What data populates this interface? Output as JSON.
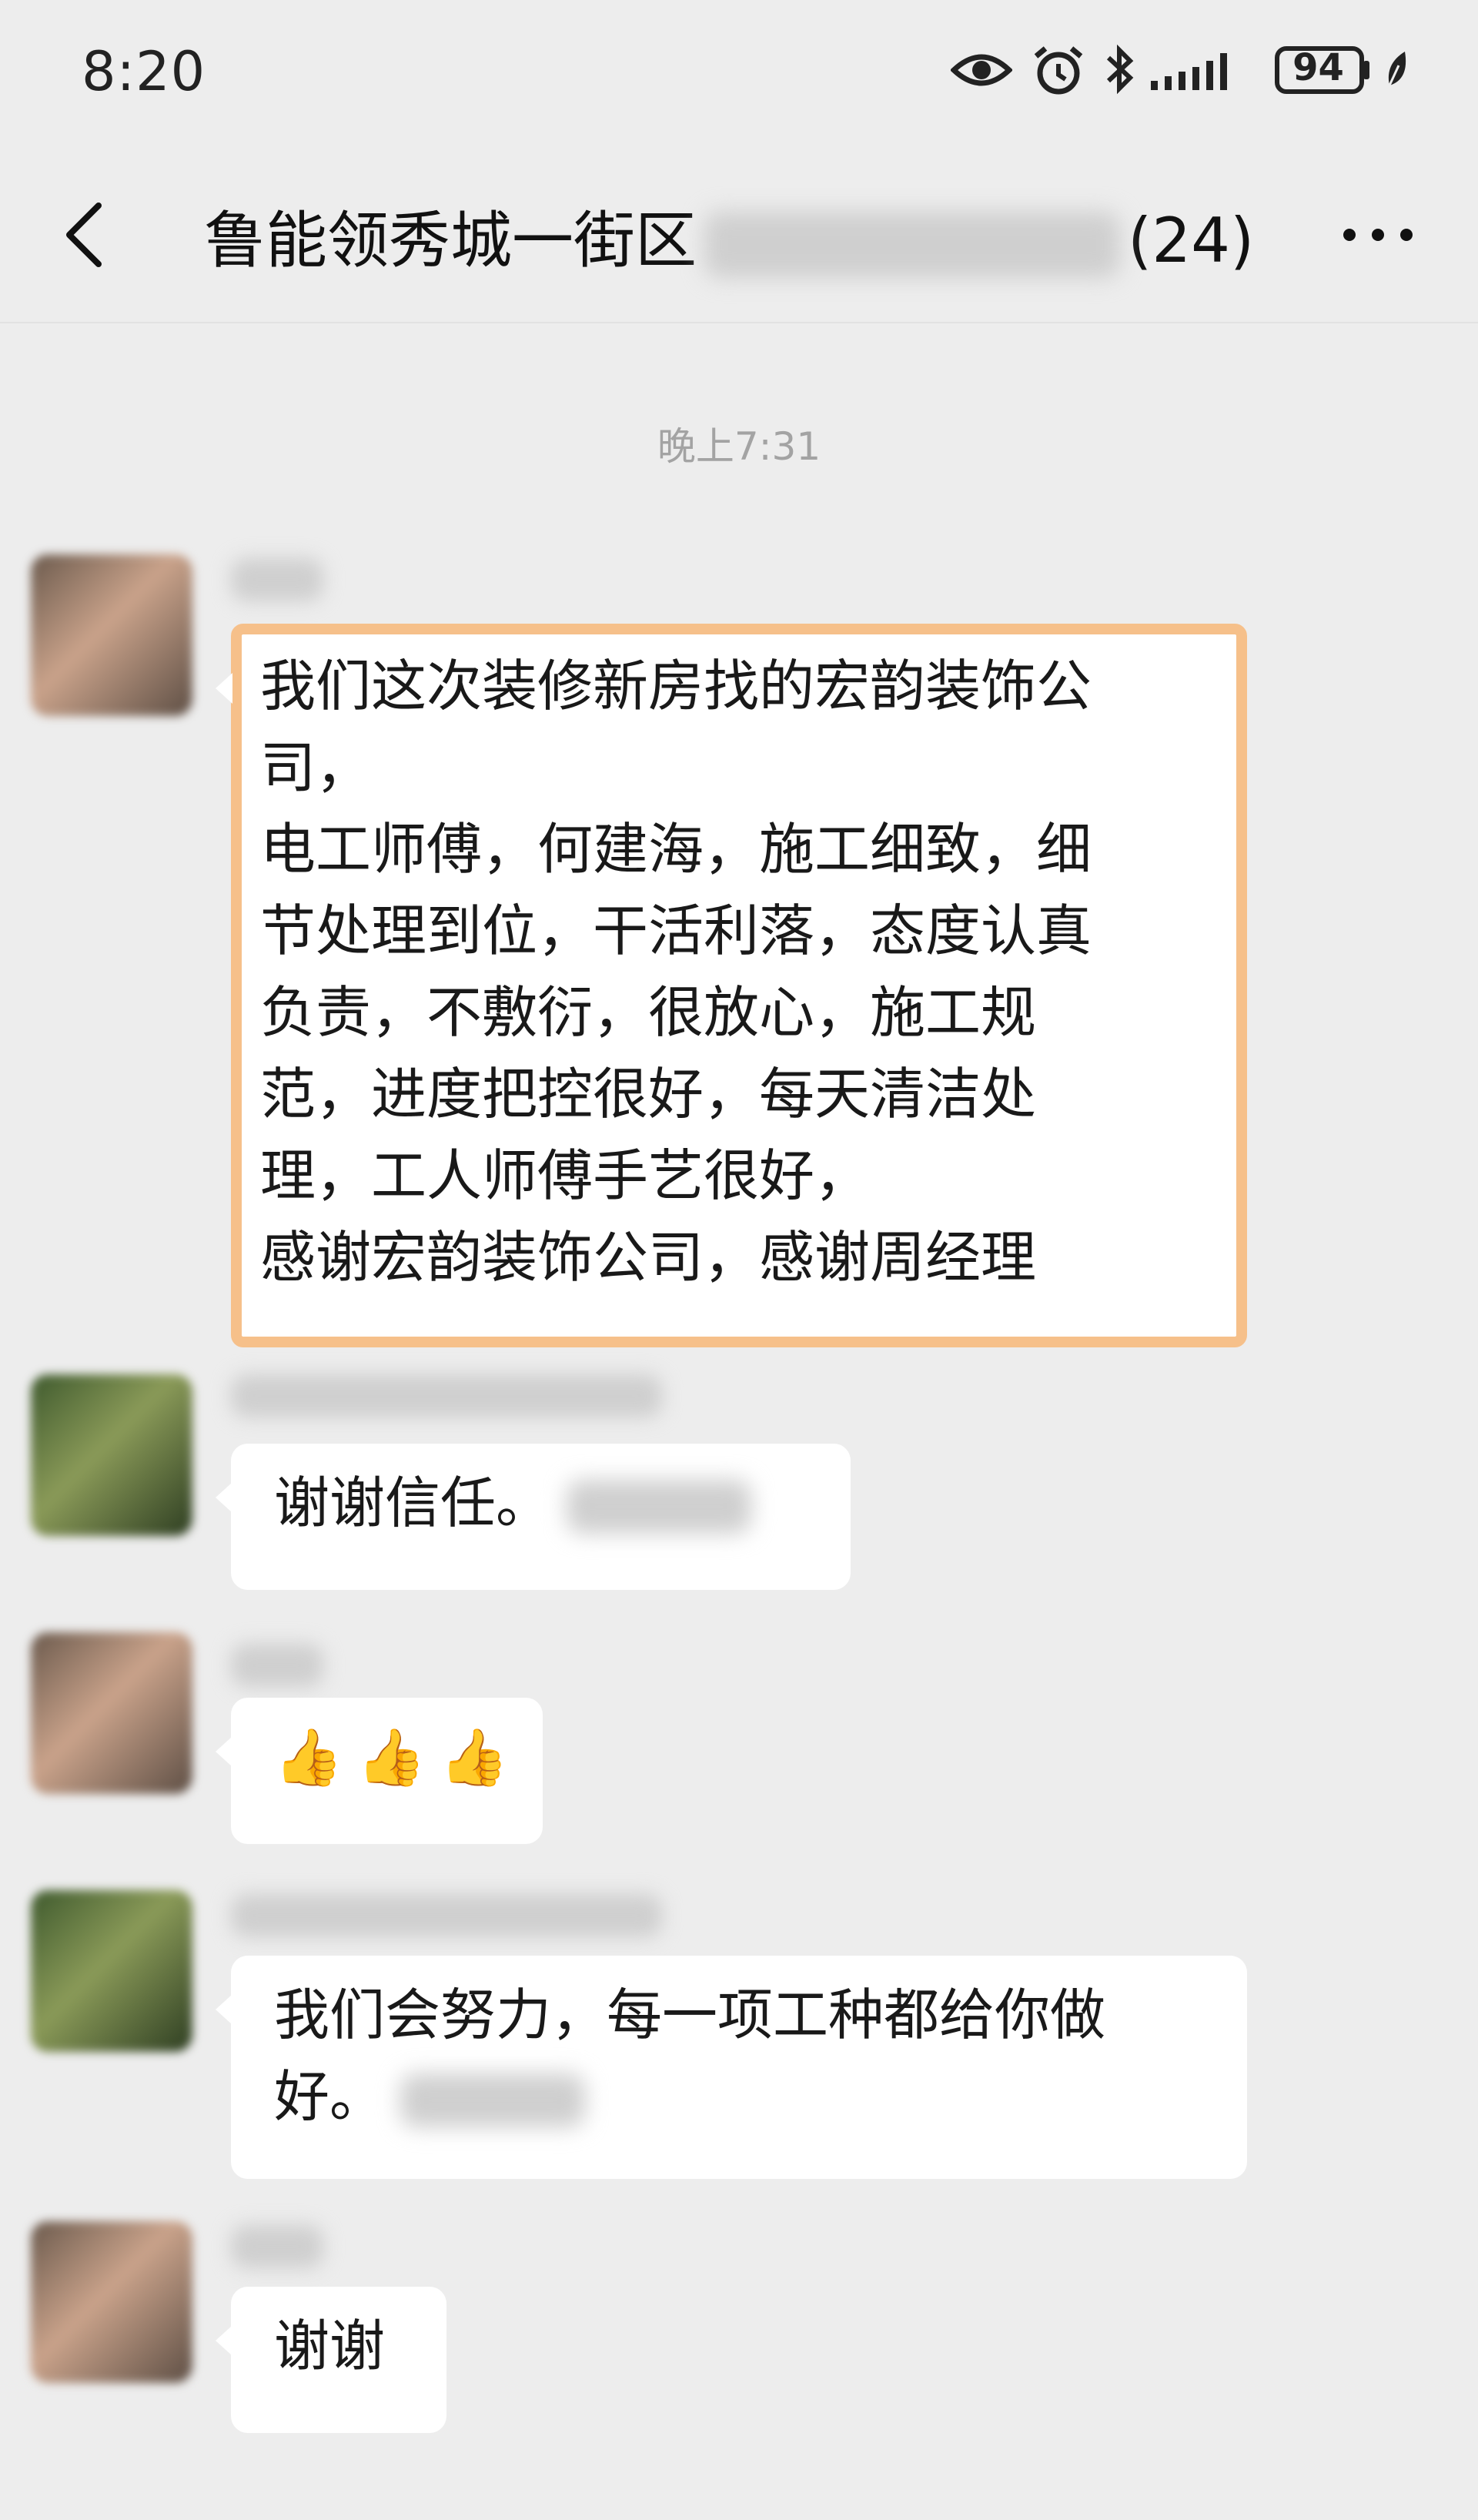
{
  "status_bar": {
    "time": "8:20",
    "battery": "94",
    "icons": [
      "eye-icon",
      "alarm-icon",
      "bluetooth-icon",
      "signal-icon",
      "battery-icon",
      "leaf-icon"
    ]
  },
  "nav": {
    "title_prefix": "鲁能领秀城一街区",
    "title_suffix": "(24)",
    "back_icon": "chevron-left-icon",
    "more_icon": "more-icon"
  },
  "timestamp": "晚上7:31",
  "messages": [
    {
      "lines": [
        "我们这次装修新房找的宏韵装饰公",
        "司，",
        "电工师傅，何建海，施工细致，细",
        "节处理到位，干活利落，态度认真",
        "负责，不敷衍，很放心，施工规",
        "范，进度把控很好，每天清洁处",
        "理，工人师傅手艺很好，",
        "感谢宏韵装饰公司，感谢周经理"
      ]
    },
    {
      "text": "谢谢信任。"
    },
    {
      "emoji": [
        "👍",
        "👍",
        "👍"
      ]
    },
    {
      "lines": [
        "我们会努力，每一项工种都给你做",
        "好。"
      ]
    },
    {
      "text": "谢谢"
    }
  ]
}
